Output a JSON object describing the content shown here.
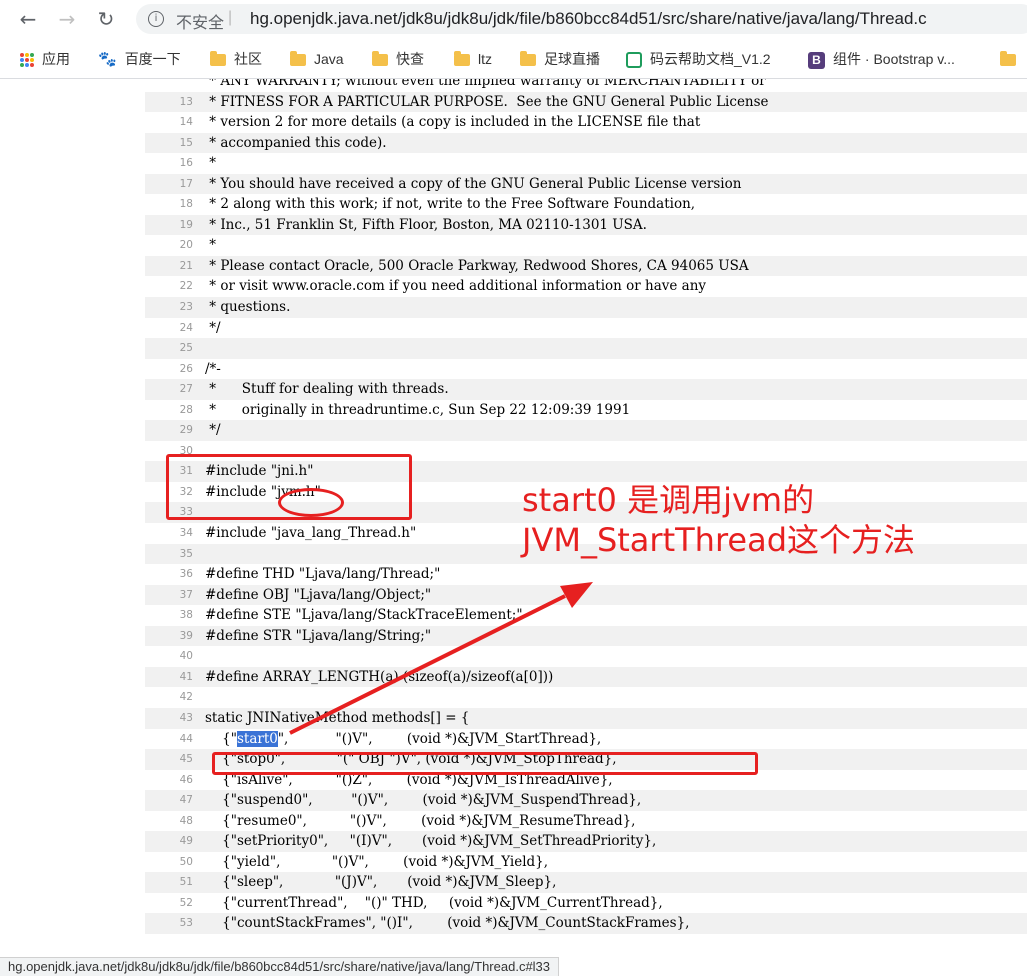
{
  "address_bar": {
    "insecure_label": "不安全",
    "separator": "|",
    "url": "hg.openjdk.java.net/jdk8u/jdk8u/jdk/file/b860bcc84d51/src/share/native/java/lang/Thread.c"
  },
  "bookmarks": [
    {
      "label": "应用",
      "icon": "apps-grid-icon"
    },
    {
      "label": "百度一下",
      "icon": "baidu-paw-icon"
    },
    {
      "label": "社区",
      "icon": "folder-icon"
    },
    {
      "label": "Java",
      "icon": "folder-icon"
    },
    {
      "label": "快查",
      "icon": "folder-icon"
    },
    {
      "label": "ltz",
      "icon": "folder-icon"
    },
    {
      "label": "足球直播",
      "icon": "folder-icon"
    },
    {
      "label": "码云帮助文档_V1.2",
      "icon": "mayun-icon"
    },
    {
      "label": "组件 · Bootstrap v...",
      "icon": "bootstrap-icon"
    },
    {
      "label": "",
      "icon": "folder-icon"
    }
  ],
  "code_lines": [
    {
      "n": "",
      "text": " * ANY WARRANTY; without even the implied warranty of MERCHANTABILITY or"
    },
    {
      "n": "13",
      "text": " * FITNESS FOR A PARTICULAR PURPOSE.  See the GNU General Public License"
    },
    {
      "n": "14",
      "text": " * version 2 for more details (a copy is included in the LICENSE file that"
    },
    {
      "n": "15",
      "text": " * accompanied this code)."
    },
    {
      "n": "16",
      "text": " *"
    },
    {
      "n": "17",
      "text": " * You should have received a copy of the GNU General Public License version"
    },
    {
      "n": "18",
      "text": " * 2 along with this work; if not, write to the Free Software Foundation,"
    },
    {
      "n": "19",
      "text": " * Inc., 51 Franklin St, Fifth Floor, Boston, MA 02110-1301 USA."
    },
    {
      "n": "20",
      "text": " *"
    },
    {
      "n": "21",
      "text": " * Please contact Oracle, 500 Oracle Parkway, Redwood Shores, CA 94065 USA"
    },
    {
      "n": "22",
      "text": " * or visit www.oracle.com if you need additional information or have any"
    },
    {
      "n": "23",
      "text": " * questions."
    },
    {
      "n": "24",
      "text": " */"
    },
    {
      "n": "25",
      "text": ""
    },
    {
      "n": "26",
      "text": "/*-"
    },
    {
      "n": "27",
      "text": " *      Stuff for dealing with threads."
    },
    {
      "n": "28",
      "text": " *      originally in threadruntime.c, Sun Sep 22 12:09:39 1991"
    },
    {
      "n": "29",
      "text": " */"
    },
    {
      "n": "30",
      "text": ""
    },
    {
      "n": "31",
      "text": "#include \"jni.h\""
    },
    {
      "n": "32",
      "text": "#include \"jvm.h\""
    },
    {
      "n": "33",
      "text": ""
    },
    {
      "n": "34",
      "text": "#include \"java_lang_Thread.h\""
    },
    {
      "n": "35",
      "text": ""
    },
    {
      "n": "36",
      "text": "#define THD \"Ljava/lang/Thread;\""
    },
    {
      "n": "37",
      "text": "#define OBJ \"Ljava/lang/Object;\""
    },
    {
      "n": "38",
      "text": "#define STE \"Ljava/lang/StackTraceElement;\""
    },
    {
      "n": "39",
      "text": "#define STR \"Ljava/lang/String;\""
    },
    {
      "n": "40",
      "text": ""
    },
    {
      "n": "41",
      "text": "#define ARRAY_LENGTH(a) (sizeof(a)/sizeof(a[0]))"
    },
    {
      "n": "42",
      "text": ""
    },
    {
      "n": "43",
      "text": "static JNINativeMethod methods[] = {"
    },
    {
      "n": "44",
      "pre": "    {\"",
      "hl": "start0",
      "text": "\",           \"()V\",        (void *)&JVM_StartThread},"
    },
    {
      "n": "45",
      "text": "    {\"stop0\",            \"(\" OBJ \")V\", (void *)&JVM_StopThread},"
    },
    {
      "n": "46",
      "text": "    {\"isAlive\",          \"()Z\",        (void *)&JVM_IsThreadAlive},"
    },
    {
      "n": "47",
      "text": "    {\"suspend0\",         \"()V\",        (void *)&JVM_SuspendThread},"
    },
    {
      "n": "48",
      "text": "    {\"resume0\",          \"()V\",        (void *)&JVM_ResumeThread},"
    },
    {
      "n": "49",
      "text": "    {\"setPriority0\",     \"(I)V\",       (void *)&JVM_SetThreadPriority},"
    },
    {
      "n": "50",
      "text": "    {\"yield\",            \"()V\",        (void *)&JVM_Yield},"
    },
    {
      "n": "51",
      "text": "    {\"sleep\",            \"(J)V\",       (void *)&JVM_Sleep},"
    },
    {
      "n": "52",
      "text": "    {\"currentThread\",    \"()\" THD,     (void *)&JVM_CurrentThread},"
    },
    {
      "n": "53",
      "text": "    {\"countStackFrames\", \"()I\",        (void *)&JVM_CountStackFrames},"
    }
  ],
  "annotation": {
    "line1": "start0 是调用jvm的",
    "line2": "JVM_StartThread这个方法",
    "color": "#e62020"
  },
  "status_bar": {
    "text": "hg.openjdk.java.net/jdk8u/jdk8u/jdk/file/b860bcc84d51/src/share/native/java/lang/Thread.c#l33"
  }
}
